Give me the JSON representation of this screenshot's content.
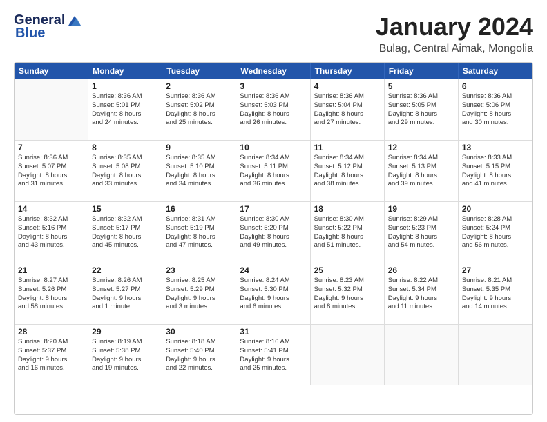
{
  "logo": {
    "line1": "General",
    "line2": "Blue"
  },
  "header": {
    "month": "January 2024",
    "location": "Bulag, Central Aimak, Mongolia"
  },
  "days": [
    "Sunday",
    "Monday",
    "Tuesday",
    "Wednesday",
    "Thursday",
    "Friday",
    "Saturday"
  ],
  "weeks": [
    [
      {
        "day": "",
        "empty": true
      },
      {
        "day": "1",
        "sunrise": "Sunrise: 8:36 AM",
        "sunset": "Sunset: 5:01 PM",
        "daylight": "Daylight: 8 hours",
        "daylight2": "and 24 minutes."
      },
      {
        "day": "2",
        "sunrise": "Sunrise: 8:36 AM",
        "sunset": "Sunset: 5:02 PM",
        "daylight": "Daylight: 8 hours",
        "daylight2": "and 25 minutes."
      },
      {
        "day": "3",
        "sunrise": "Sunrise: 8:36 AM",
        "sunset": "Sunset: 5:03 PM",
        "daylight": "Daylight: 8 hours",
        "daylight2": "and 26 minutes."
      },
      {
        "day": "4",
        "sunrise": "Sunrise: 8:36 AM",
        "sunset": "Sunset: 5:04 PM",
        "daylight": "Daylight: 8 hours",
        "daylight2": "and 27 minutes."
      },
      {
        "day": "5",
        "sunrise": "Sunrise: 8:36 AM",
        "sunset": "Sunset: 5:05 PM",
        "daylight": "Daylight: 8 hours",
        "daylight2": "and 29 minutes."
      },
      {
        "day": "6",
        "sunrise": "Sunrise: 8:36 AM",
        "sunset": "Sunset: 5:06 PM",
        "daylight": "Daylight: 8 hours",
        "daylight2": "and 30 minutes."
      }
    ],
    [
      {
        "day": "7",
        "sunrise": "Sunrise: 8:36 AM",
        "sunset": "Sunset: 5:07 PM",
        "daylight": "Daylight: 8 hours",
        "daylight2": "and 31 minutes."
      },
      {
        "day": "8",
        "sunrise": "Sunrise: 8:35 AM",
        "sunset": "Sunset: 5:08 PM",
        "daylight": "Daylight: 8 hours",
        "daylight2": "and 33 minutes."
      },
      {
        "day": "9",
        "sunrise": "Sunrise: 8:35 AM",
        "sunset": "Sunset: 5:10 PM",
        "daylight": "Daylight: 8 hours",
        "daylight2": "and 34 minutes."
      },
      {
        "day": "10",
        "sunrise": "Sunrise: 8:34 AM",
        "sunset": "Sunset: 5:11 PM",
        "daylight": "Daylight: 8 hours",
        "daylight2": "and 36 minutes."
      },
      {
        "day": "11",
        "sunrise": "Sunrise: 8:34 AM",
        "sunset": "Sunset: 5:12 PM",
        "daylight": "Daylight: 8 hours",
        "daylight2": "and 38 minutes."
      },
      {
        "day": "12",
        "sunrise": "Sunrise: 8:34 AM",
        "sunset": "Sunset: 5:13 PM",
        "daylight": "Daylight: 8 hours",
        "daylight2": "and 39 minutes."
      },
      {
        "day": "13",
        "sunrise": "Sunrise: 8:33 AM",
        "sunset": "Sunset: 5:15 PM",
        "daylight": "Daylight: 8 hours",
        "daylight2": "and 41 minutes."
      }
    ],
    [
      {
        "day": "14",
        "sunrise": "Sunrise: 8:32 AM",
        "sunset": "Sunset: 5:16 PM",
        "daylight": "Daylight: 8 hours",
        "daylight2": "and 43 minutes."
      },
      {
        "day": "15",
        "sunrise": "Sunrise: 8:32 AM",
        "sunset": "Sunset: 5:17 PM",
        "daylight": "Daylight: 8 hours",
        "daylight2": "and 45 minutes."
      },
      {
        "day": "16",
        "sunrise": "Sunrise: 8:31 AM",
        "sunset": "Sunset: 5:19 PM",
        "daylight": "Daylight: 8 hours",
        "daylight2": "and 47 minutes."
      },
      {
        "day": "17",
        "sunrise": "Sunrise: 8:30 AM",
        "sunset": "Sunset: 5:20 PM",
        "daylight": "Daylight: 8 hours",
        "daylight2": "and 49 minutes."
      },
      {
        "day": "18",
        "sunrise": "Sunrise: 8:30 AM",
        "sunset": "Sunset: 5:22 PM",
        "daylight": "Daylight: 8 hours",
        "daylight2": "and 51 minutes."
      },
      {
        "day": "19",
        "sunrise": "Sunrise: 8:29 AM",
        "sunset": "Sunset: 5:23 PM",
        "daylight": "Daylight: 8 hours",
        "daylight2": "and 54 minutes."
      },
      {
        "day": "20",
        "sunrise": "Sunrise: 8:28 AM",
        "sunset": "Sunset: 5:24 PM",
        "daylight": "Daylight: 8 hours",
        "daylight2": "and 56 minutes."
      }
    ],
    [
      {
        "day": "21",
        "sunrise": "Sunrise: 8:27 AM",
        "sunset": "Sunset: 5:26 PM",
        "daylight": "Daylight: 8 hours",
        "daylight2": "and 58 minutes."
      },
      {
        "day": "22",
        "sunrise": "Sunrise: 8:26 AM",
        "sunset": "Sunset: 5:27 PM",
        "daylight": "Daylight: 9 hours",
        "daylight2": "and 1 minute."
      },
      {
        "day": "23",
        "sunrise": "Sunrise: 8:25 AM",
        "sunset": "Sunset: 5:29 PM",
        "daylight": "Daylight: 9 hours",
        "daylight2": "and 3 minutes."
      },
      {
        "day": "24",
        "sunrise": "Sunrise: 8:24 AM",
        "sunset": "Sunset: 5:30 PM",
        "daylight": "Daylight: 9 hours",
        "daylight2": "and 6 minutes."
      },
      {
        "day": "25",
        "sunrise": "Sunrise: 8:23 AM",
        "sunset": "Sunset: 5:32 PM",
        "daylight": "Daylight: 9 hours",
        "daylight2": "and 8 minutes."
      },
      {
        "day": "26",
        "sunrise": "Sunrise: 8:22 AM",
        "sunset": "Sunset: 5:34 PM",
        "daylight": "Daylight: 9 hours",
        "daylight2": "and 11 minutes."
      },
      {
        "day": "27",
        "sunrise": "Sunrise: 8:21 AM",
        "sunset": "Sunset: 5:35 PM",
        "daylight": "Daylight: 9 hours",
        "daylight2": "and 14 minutes."
      }
    ],
    [
      {
        "day": "28",
        "sunrise": "Sunrise: 8:20 AM",
        "sunset": "Sunset: 5:37 PM",
        "daylight": "Daylight: 9 hours",
        "daylight2": "and 16 minutes."
      },
      {
        "day": "29",
        "sunrise": "Sunrise: 8:19 AM",
        "sunset": "Sunset: 5:38 PM",
        "daylight": "Daylight: 9 hours",
        "daylight2": "and 19 minutes."
      },
      {
        "day": "30",
        "sunrise": "Sunrise: 8:18 AM",
        "sunset": "Sunset: 5:40 PM",
        "daylight": "Daylight: 9 hours",
        "daylight2": "and 22 minutes."
      },
      {
        "day": "31",
        "sunrise": "Sunrise: 8:16 AM",
        "sunset": "Sunset: 5:41 PM",
        "daylight": "Daylight: 9 hours",
        "daylight2": "and 25 minutes."
      },
      {
        "day": "",
        "empty": true
      },
      {
        "day": "",
        "empty": true
      },
      {
        "day": "",
        "empty": true
      }
    ]
  ]
}
